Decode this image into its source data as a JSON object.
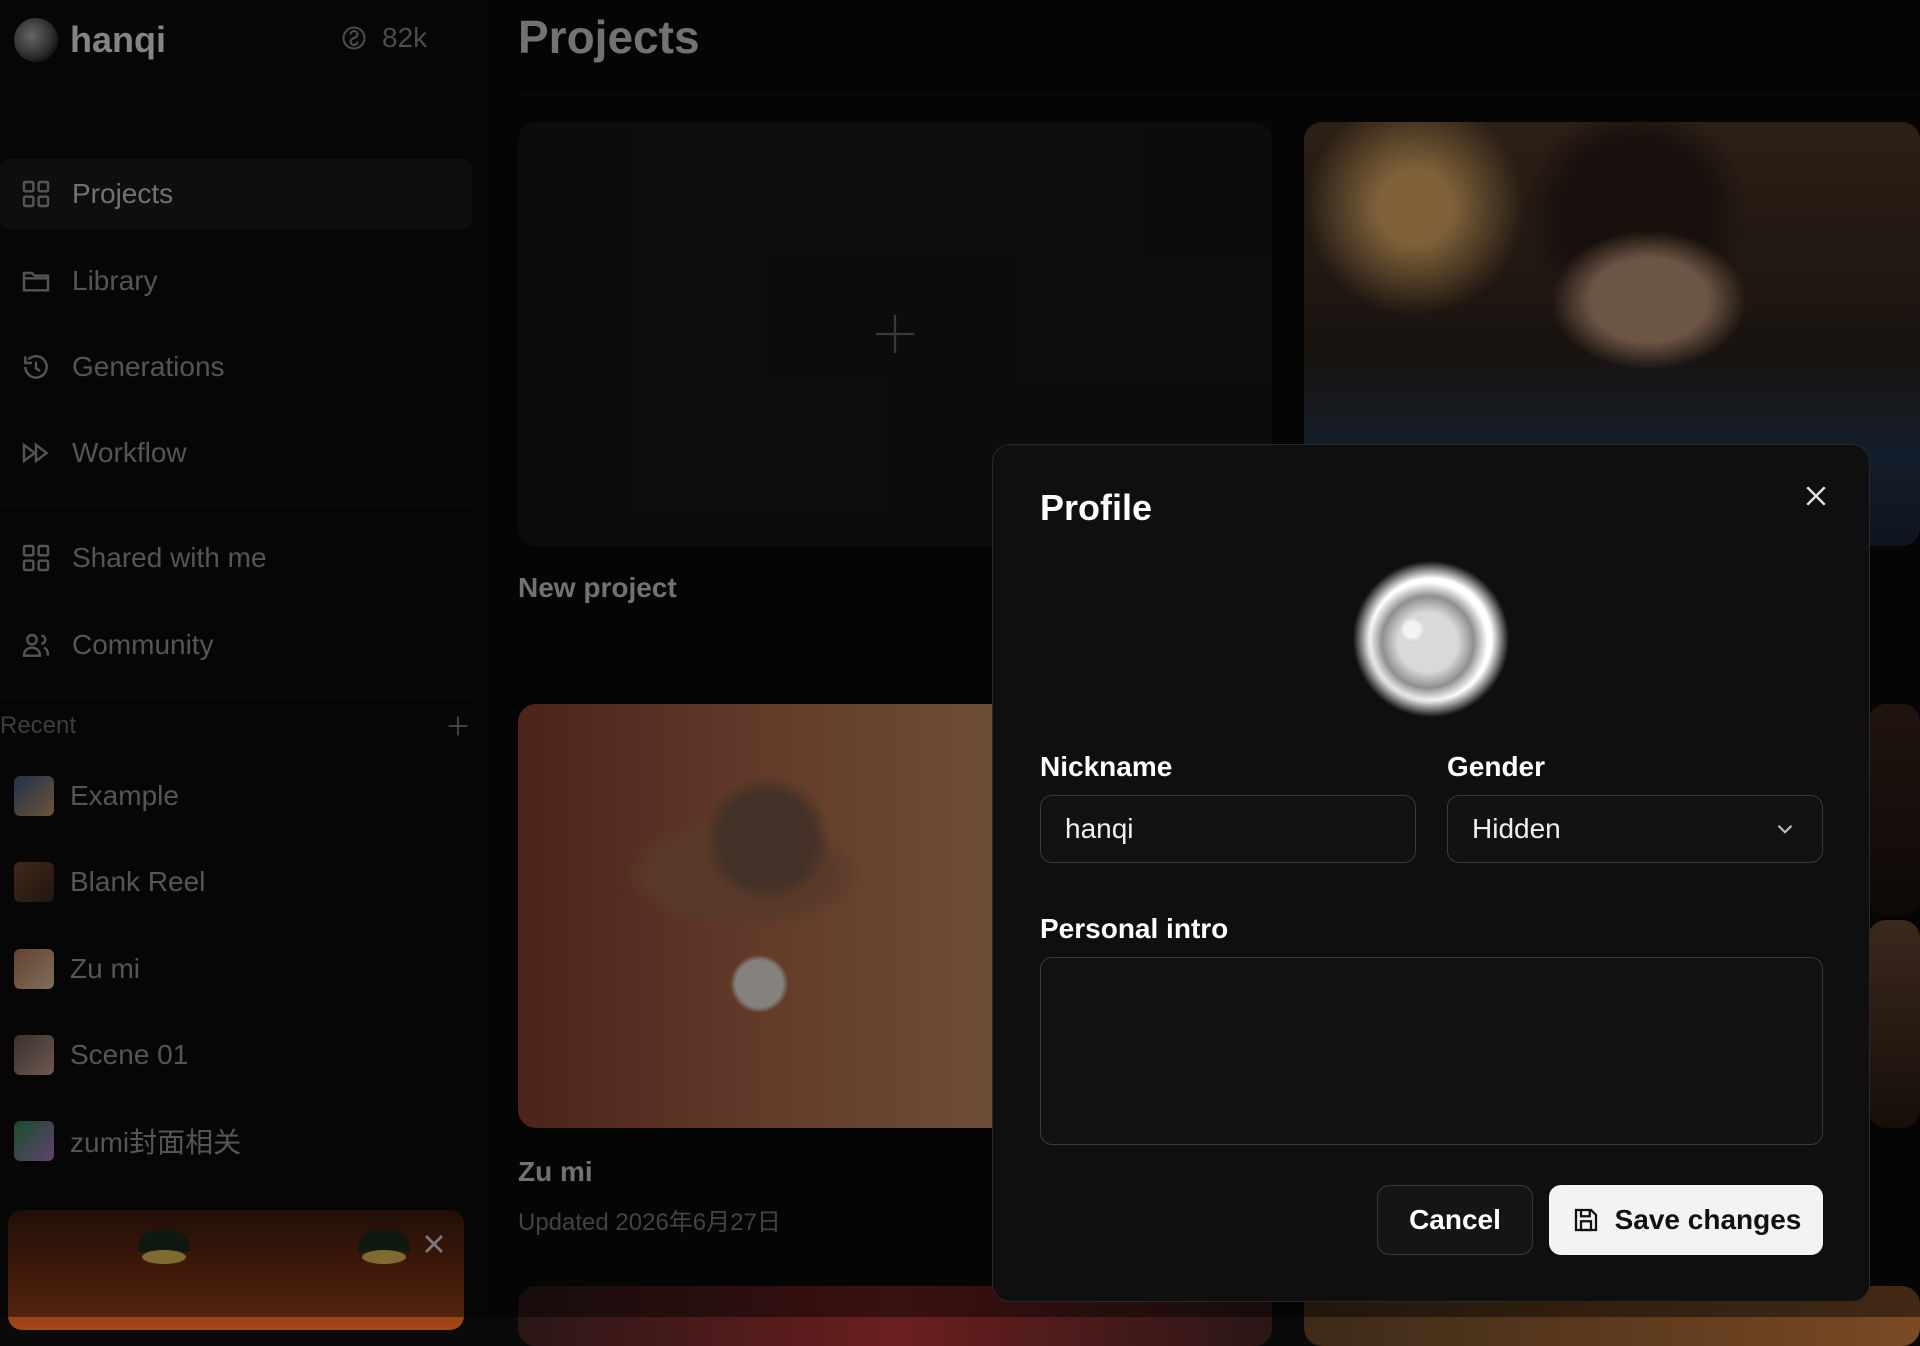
{
  "sidebar": {
    "username": "hanqi",
    "credits": "82k",
    "nav": [
      {
        "label": "Projects",
        "icon": "grid-icon"
      },
      {
        "label": "Library",
        "icon": "folder-icon"
      },
      {
        "label": "Generations",
        "icon": "history-icon"
      },
      {
        "label": "Workflow",
        "icon": "fast-forward-icon"
      },
      {
        "label": "Shared with me",
        "icon": "grid-icon"
      },
      {
        "label": "Community",
        "icon": "users-icon"
      }
    ],
    "recent_label": "Recent",
    "recent": [
      {
        "label": "Example",
        "color": "#3b5a8a"
      },
      {
        "label": "Blank Reel",
        "color": "#7a4a30"
      },
      {
        "label": "Zu mi",
        "color": "#b77a55"
      },
      {
        "label": "Scene 01",
        "color": "#6a5a55"
      },
      {
        "label": "zumi封面相关",
        "color": "#2f8a4f"
      }
    ]
  },
  "main": {
    "title": "Projects",
    "new_project_label": "New project",
    "project_card": {
      "name": "Zu mi",
      "updated": "Updated 2026年6月27日"
    }
  },
  "modal": {
    "title": "Profile",
    "nickname_label": "Nickname",
    "nickname_value": "hanqi",
    "gender_label": "Gender",
    "gender_value": "Hidden",
    "intro_label": "Personal intro",
    "intro_value": "",
    "cancel_label": "Cancel",
    "save_label": "Save changes"
  }
}
